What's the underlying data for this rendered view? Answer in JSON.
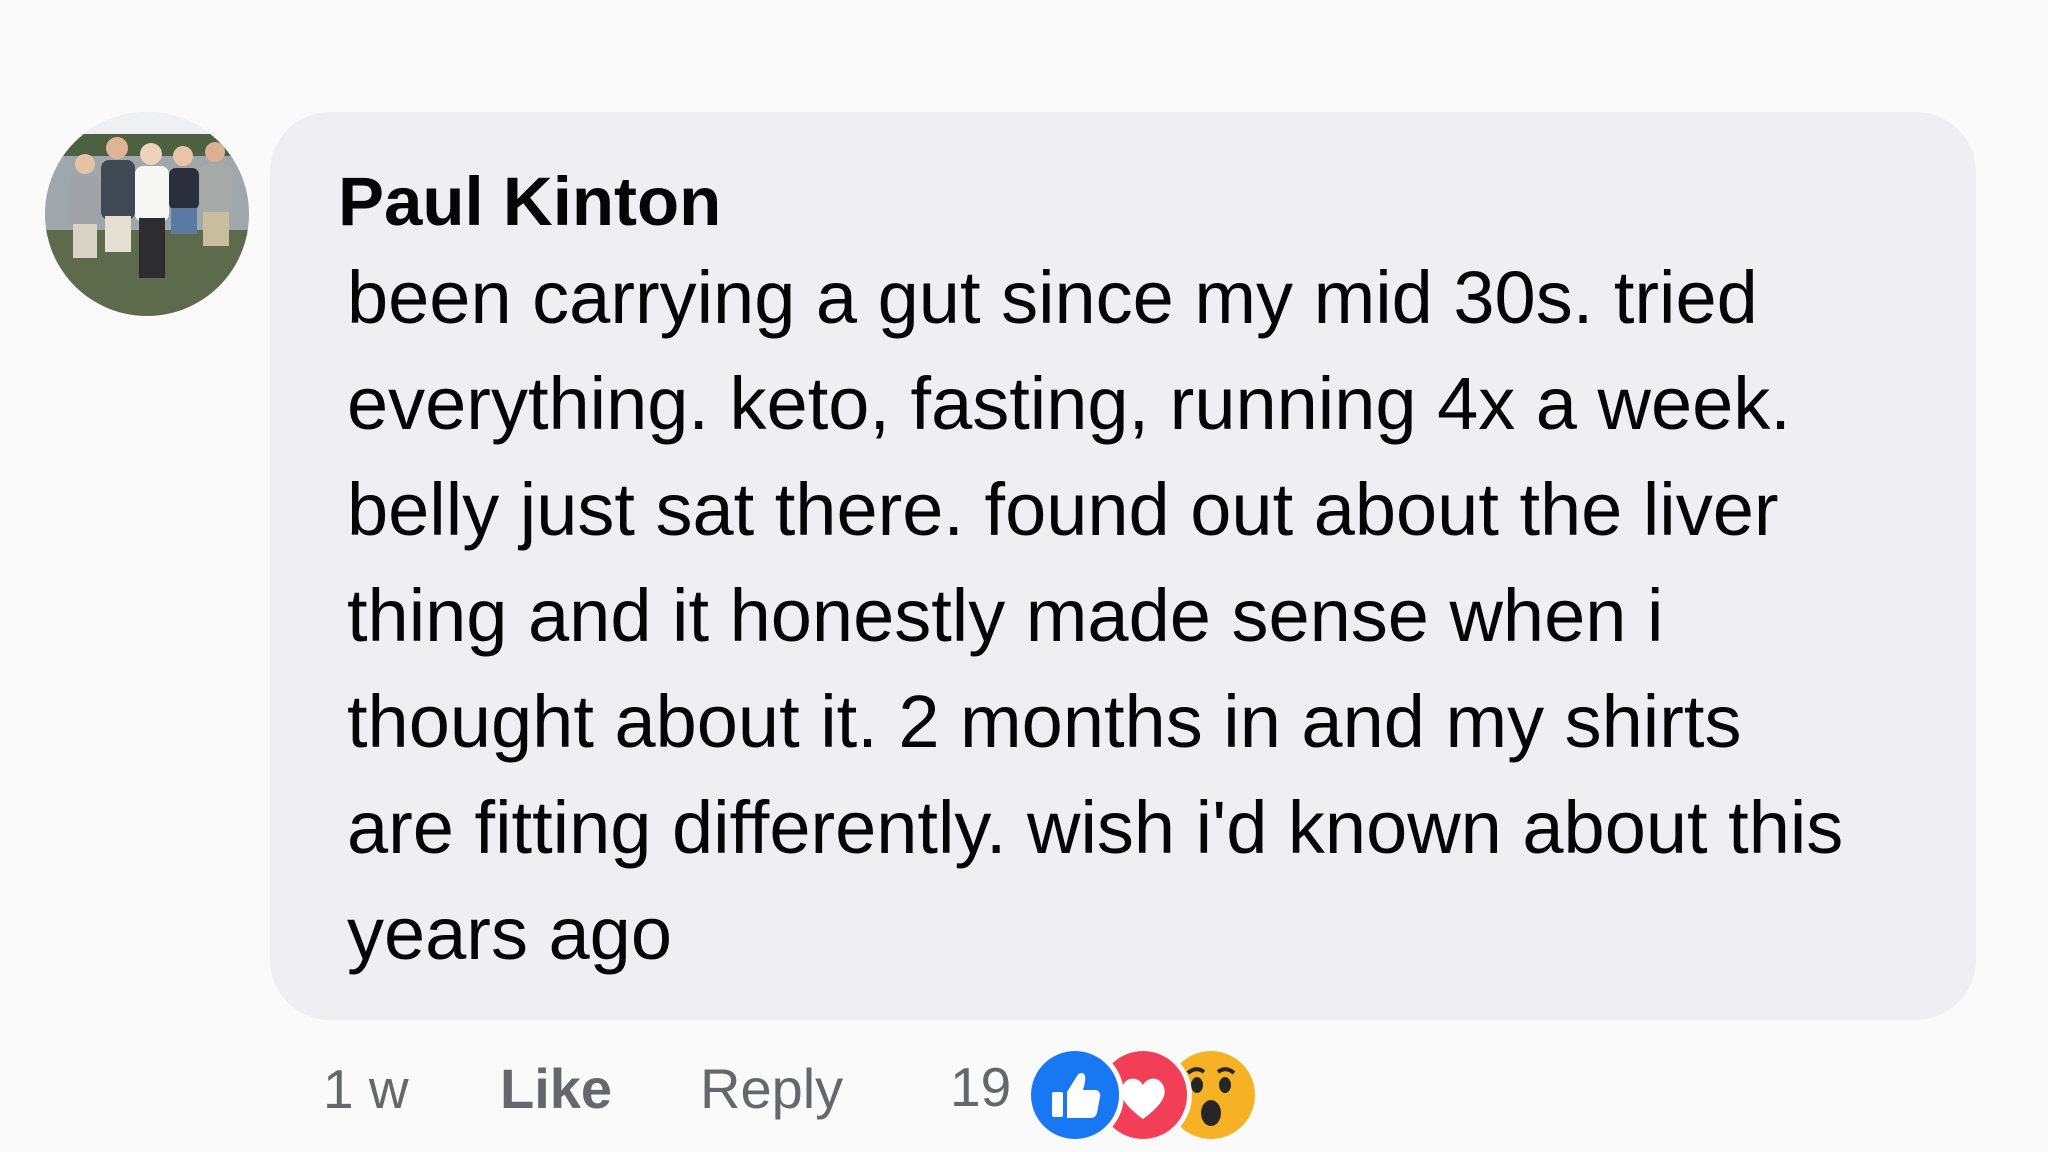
{
  "comment": {
    "author": "Paul Kinton",
    "lines": [
      "been carrying a gut since my mid 30s. tried",
      "everything. keto, fasting, running 4x a week.",
      "belly just sat there. found out about the liver",
      "thing and it honestly made sense when i",
      "thought about it. 2 months in and my shirts",
      "are fitting differently. wish i'd known about this",
      "years ago"
    ]
  },
  "actions": {
    "timestamp": "1 w",
    "like_label": "Like",
    "reply_label": "Reply",
    "reaction_count": "19",
    "reactions": [
      "like-icon",
      "love-icon",
      "wow-icon"
    ]
  },
  "colors": {
    "page_background": "#fafafa",
    "bubble_background": "#efeff2",
    "text": "#050505",
    "secondary_text": "#65676b",
    "like_blue": "#1877f2",
    "love_red": "#f33e58",
    "wow_yellow": "#f7b125"
  }
}
